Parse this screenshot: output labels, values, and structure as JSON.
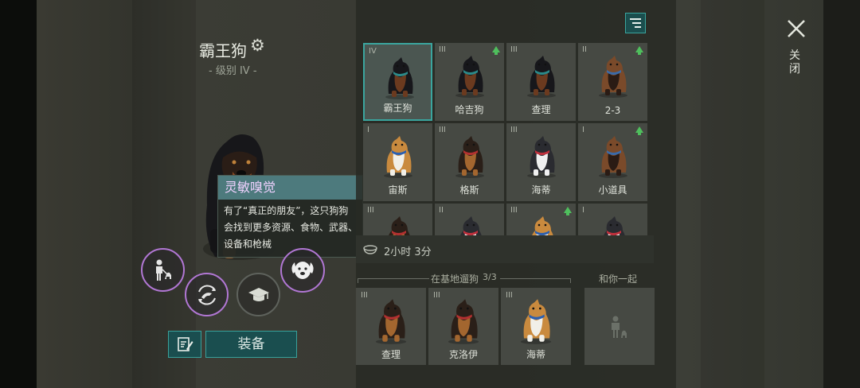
{
  "dog": {
    "name": "霸王狗",
    "level": "- 级别 IV -"
  },
  "tooltip": {
    "title": "灵敏嗅觉",
    "body": "有了“真正的朋友”，这只狗狗会找到更多资源、食物、武器、设备和枪械"
  },
  "actions": {
    "equip_label": "装备"
  },
  "grid": [
    {
      "rank": "IV",
      "name": "霸王狗",
      "selected": true,
      "upgrade": false,
      "breed": "rottweiler"
    },
    {
      "rank": "III",
      "name": "哈吉狗",
      "selected": false,
      "upgrade": true,
      "breed": "rottweiler"
    },
    {
      "rank": "III",
      "name": "查理",
      "selected": false,
      "upgrade": false,
      "breed": "rottweiler"
    },
    {
      "rank": "II",
      "name": "2-3",
      "selected": false,
      "upgrade": true,
      "breed": "mastiff"
    },
    {
      "rank": "I",
      "name": "宙斯",
      "selected": false,
      "upgrade": false,
      "breed": "corgi"
    },
    {
      "rank": "III",
      "name": "格斯",
      "selected": false,
      "upgrade": false,
      "breed": "shepherd"
    },
    {
      "rank": "III",
      "name": "海蒂",
      "selected": false,
      "upgrade": false,
      "breed": "husky"
    },
    {
      "rank": "I",
      "name": "小道具",
      "selected": false,
      "upgrade": true,
      "breed": "mastiff"
    },
    {
      "rank": "III",
      "name": "",
      "selected": false,
      "upgrade": false,
      "breed": "shepherd"
    },
    {
      "rank": "II",
      "name": "",
      "selected": false,
      "upgrade": false,
      "breed": "husky"
    },
    {
      "rank": "III",
      "name": "",
      "selected": false,
      "upgrade": true,
      "breed": "corgi"
    },
    {
      "rank": "I",
      "name": "",
      "selected": false,
      "upgrade": false,
      "breed": "husky"
    }
  ],
  "timer": {
    "text": "2小时 3分"
  },
  "base_walk": {
    "label": "在基地遛狗",
    "count": "3/3",
    "dogs": [
      {
        "rank": "III",
        "name": "查理",
        "breed": "shepherd"
      },
      {
        "rank": "III",
        "name": "克洛伊",
        "breed": "shepherd"
      },
      {
        "rank": "III",
        "name": "海蒂",
        "breed": "corgi"
      }
    ]
  },
  "with_you": {
    "label": "和你一起"
  },
  "close": {
    "label": "关闭"
  },
  "colors": {
    "accent": "#3aa59e",
    "button_bg": "#1a4e4f",
    "ability_ring": "#b177d4",
    "tooltip_head": "#4d7a7d",
    "upgrade_arrow": "#4fbf5d"
  },
  "icons": [
    "gear-icon",
    "filter-icon",
    "close-icon",
    "walk-person-icon",
    "dog-face-icon",
    "recall-icon",
    "graduation-cap-icon",
    "notes-icon",
    "bowl-icon",
    "person-dog-icon"
  ]
}
